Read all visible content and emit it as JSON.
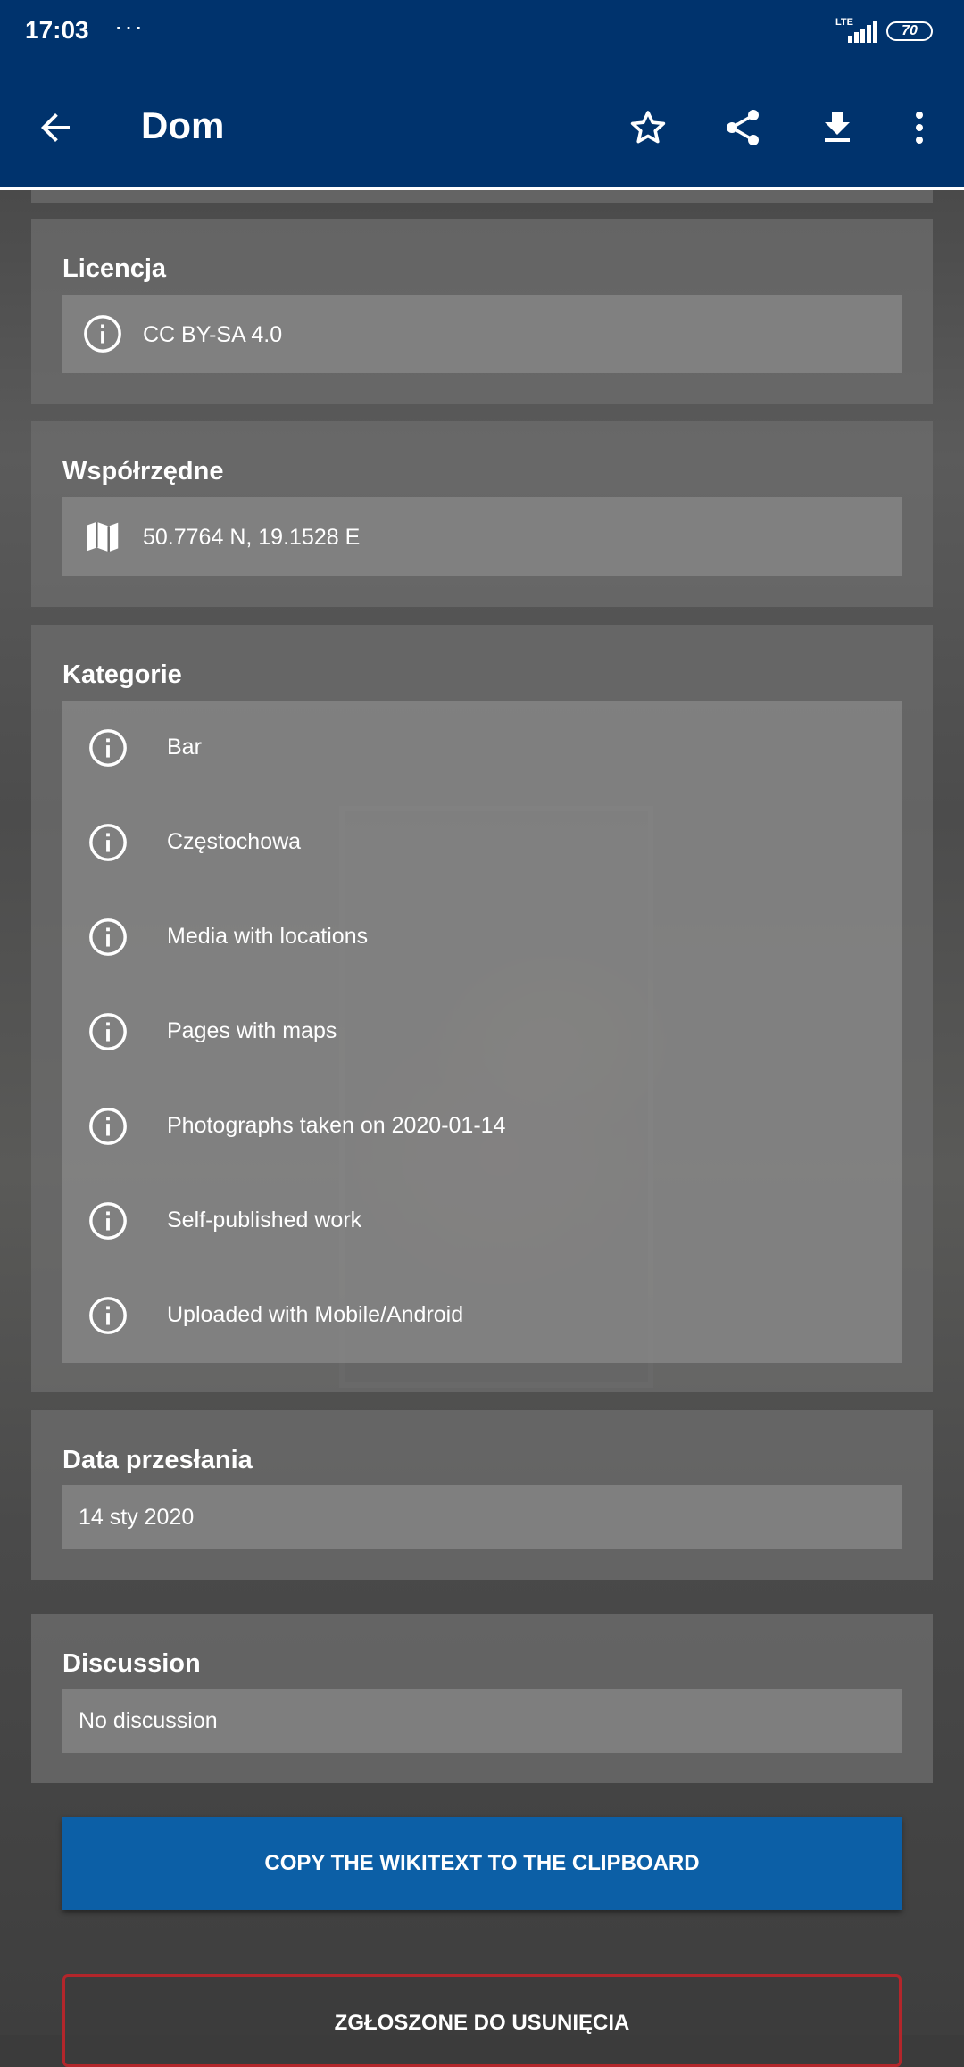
{
  "status_bar": {
    "time": "17:03",
    "dots": "···",
    "network": "LTE",
    "battery": "70"
  },
  "app_bar": {
    "title": "Dom"
  },
  "license": {
    "title": "Licencja",
    "value": "CC BY-SA 4.0"
  },
  "coordinates": {
    "title": "Współrzędne",
    "value": "50.7764 N, 19.1528 E"
  },
  "categories": {
    "title": "Kategorie",
    "items": [
      "Bar",
      "Częstochowa",
      "Media with locations",
      "Pages with maps",
      "Photographs taken on 2020-01-14",
      "Self-published work",
      "Uploaded with Mobile/Android"
    ]
  },
  "upload_date": {
    "title": "Data przesłania",
    "value": "14 sty 2020"
  },
  "discussion": {
    "title": "Discussion",
    "value": "No discussion"
  },
  "actions": {
    "copy_wikitext": "COPY THE WIKITEXT TO THE CLIPBOARD",
    "nominated_deletion": "ZGŁOSZONE DO USUNIĘCIA"
  },
  "icons": {
    "back": "back-arrow-icon",
    "star": "star-icon",
    "share": "share-icon",
    "download": "download-icon",
    "more": "more-vert-icon",
    "info": "info-icon",
    "map": "map-icon"
  },
  "colors": {
    "app_bar": "#00336d",
    "primary_button": "#0c5fa6",
    "danger_border": "#b3262b"
  }
}
